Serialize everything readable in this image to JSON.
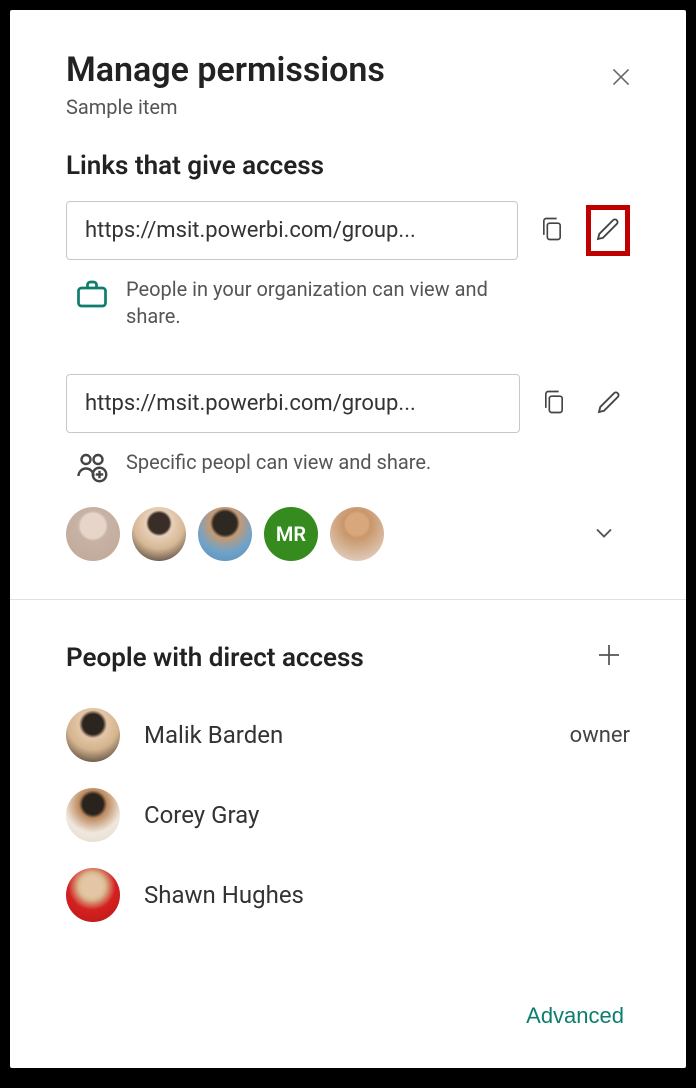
{
  "header": {
    "title": "Manage permissions",
    "subtitle": "Sample item"
  },
  "links_section": {
    "title": "Links that give access",
    "links": [
      {
        "url": "https://msit.powerbi.com/group...",
        "description": "People in your organization can view and share."
      },
      {
        "url": "https://msit.powerbi.com/group...",
        "description": "Specific peopl can view and share."
      }
    ],
    "shared_people_initials": "MR"
  },
  "direct_section": {
    "title": "People with direct access",
    "people": [
      {
        "name": "Malik Barden",
        "role": "owner"
      },
      {
        "name": "Corey Gray",
        "role": ""
      },
      {
        "name": "Shawn Hughes",
        "role": ""
      }
    ]
  },
  "footer": {
    "advanced": "Advanced"
  }
}
